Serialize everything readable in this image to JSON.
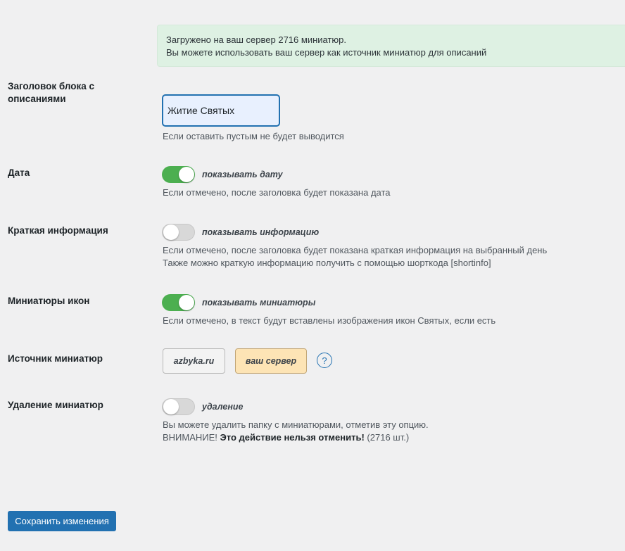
{
  "notice": {
    "line1": "Загружено на ваш сервер 2716 миниатюр.",
    "line2": "Вы можете использовать ваш сервер как источник миниатюр для описаний"
  },
  "block_title": {
    "label_line1": "Заголовок блока с",
    "label_line2": "описаниями",
    "value": "Житие Святых",
    "desc": "Если оставить пустым не будет выводится"
  },
  "date": {
    "label": "Дата",
    "toggle_on": true,
    "toggle_label": "показывать дату",
    "desc": "Если отмечено, после заголовка будет показана дата"
  },
  "short_info": {
    "label": "Краткая информация",
    "toggle_on": false,
    "toggle_label": "показывать информацию",
    "desc_line1": "Если отмечено, после заголовка будет показана краткая информация на выбранный день",
    "desc_line2": "Также можно краткую информацию получить с помощью шорткода [shortinfo]"
  },
  "icon_thumbs": {
    "label": "Миниатюры икон",
    "toggle_on": true,
    "toggle_label": "показывать миниатюры",
    "desc": "Если отмечено, в текст будут вставлены изображения икон Святых, если есть"
  },
  "thumb_source": {
    "label": "Источник миниатюр",
    "option_azbyka": "azbyka.ru",
    "option_server": "ваш сервер",
    "selected": "ваш сервер",
    "help": "?"
  },
  "thumb_delete": {
    "label": "Удаление миниатюр",
    "toggle_on": false,
    "toggle_label": "удаление",
    "desc_line1": "Вы можете удалить папку с миниатюрами, отметив эту опцию.",
    "warning_prefix": "ВНИМАНИЕ!",
    "warning_bold": "Это действие нельзя отменить!",
    "warning_suffix": "(2716 шт.)"
  },
  "save_label": "Сохранить изменения",
  "colors": {
    "accent": "#2271b1",
    "toggle_on": "#4caf50",
    "notice_bg": "#def1e3",
    "selected_option_bg": "#fde4b5"
  }
}
